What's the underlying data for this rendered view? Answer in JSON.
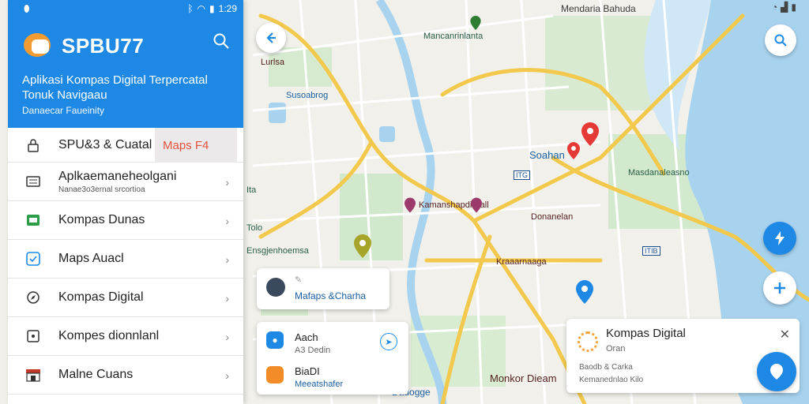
{
  "phone_status": {
    "time": "1:29"
  },
  "map_top_status": {
    "place": "Mendaria Bahuda"
  },
  "drawer": {
    "brand": "SPBU77",
    "tagline_line1": "Aplikasi Kompas Digital Terpercatal",
    "tagline_line2": "Tonuk Navigaau",
    "sub": "Danaecar Faueinity",
    "menu": [
      {
        "label": "SPU&3 & Cuatal",
        "active_tab": "Maps F4"
      },
      {
        "label": "Aplkaemaneheolgani",
        "sub": "Nanae3o3ernal srcortioa"
      },
      {
        "label": "Kompas Dunas"
      },
      {
        "label": "Maps Auacl"
      },
      {
        "label": "Kompas Digital"
      },
      {
        "label": "Kompes dionnlanl"
      },
      {
        "label": "Malne Cuans"
      }
    ]
  },
  "map_labels": {
    "top_center": "Mancanrinlanta",
    "left1": "Susoabrog",
    "left2": "Lurlsa",
    "left3": "Ensgjenhoemsa",
    "mid_pin": "Kamanshapdi Eall",
    "soahan": "Soahan",
    "center1": "Donanelan",
    "center2": "Kraaarnaaga",
    "right1": "Masdanaleasno",
    "bottom_mid": "Monkor Dieam",
    "bottom_map": "Dauogge",
    "left_small1": "Ita",
    "left_small2": "Tolo",
    "road1": "ITG",
    "road2": "ITIB"
  },
  "cards": {
    "card1_title": "Mafaps &Charha",
    "card2_title": "Aach",
    "card2_sub": "A3 Dedin",
    "card2b_title": "BiaDI",
    "card2b_sub": "Meeatshafer",
    "card3_title": "Kompas Digital",
    "card3_rating": "Oran",
    "card3_line1": "Baodb & Carka",
    "card3_line2": "Kemanednlao Kilo"
  },
  "colors": {
    "accent": "#1e88e5",
    "road": "#f2c94c",
    "water": "#a8d3ef",
    "park": "#cfe7c6",
    "active_text": "#e5533e"
  }
}
